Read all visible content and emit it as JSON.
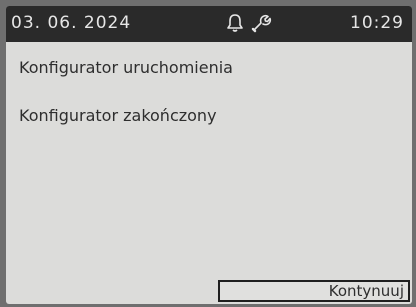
{
  "status_bar": {
    "date": "03. 06. 2024",
    "time": "10:29",
    "icons": [
      "bell-icon",
      "wrench-icon"
    ]
  },
  "content": {
    "title": "Konfigurator uruchomienia",
    "message": "Konfigurator zakończony"
  },
  "actions": {
    "continue_label": "Kontynuuj"
  },
  "colors": {
    "status_bar_bg": "#2a2a2a",
    "screen_bg": "#dcdcda",
    "text": "#2e2e2e"
  }
}
